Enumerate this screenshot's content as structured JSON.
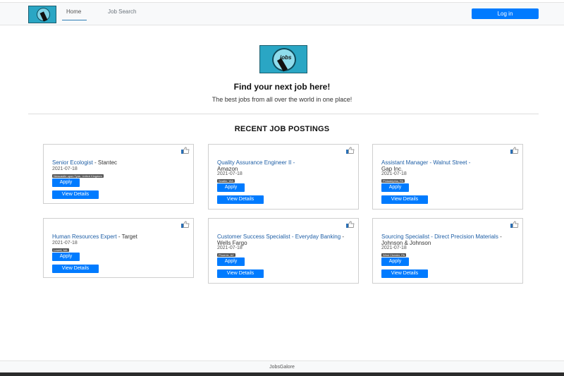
{
  "nav": {
    "logo_icon": "jobs-logo-icon",
    "home_label": "Home",
    "search_label": "Job Search",
    "login_label": "Log in",
    "accent_color": "#007bff"
  },
  "hero": {
    "logo_text": "jobs",
    "title": "Find your next job here!",
    "subtitle": "The best jobs from all over the world in one place!"
  },
  "section": {
    "title": "RECENT JOB POSTINGS"
  },
  "jobs": [
    {
      "title": "Senior Ecologist",
      "company": "Stantec",
      "date": "2021-07-18",
      "location": "Newcastle upon Tyne, United Kingdom",
      "apply_label": "Apply",
      "details_label": "View Details",
      "like_icon": "thumbs-up-icon"
    },
    {
      "title": "Quality Assurance Engineer II",
      "company": "Amazon",
      "date": "2021-07-18",
      "location": "Seattle, WA",
      "apply_label": "Apply",
      "details_label": "View Details",
      "like_icon": "thumbs-up-icon"
    },
    {
      "title": "Assistant Manager - Walnut Street",
      "company": "Gap Inc.",
      "date": "2021-07-18",
      "location": "Philadelphia, PA",
      "apply_label": "Apply",
      "details_label": "View Details",
      "like_icon": "thumbs-up-icon"
    },
    {
      "title": "Human Resources Expert",
      "company": "Target",
      "date": "2021-07-18",
      "location": "Lowell, MA",
      "apply_label": "Apply",
      "details_label": "View Details",
      "like_icon": "thumbs-up-icon"
    },
    {
      "title": "Customer Success Specialist - Everyday Banking",
      "company": "Wells Fargo",
      "date": "2021-07-18",
      "location": "Phoenix, AZ",
      "apply_label": "Apply",
      "details_label": "View Details",
      "like_icon": "thumbs-up-icon"
    },
    {
      "title": "Sourcing Specialist - Direct Precision Materials",
      "company": "Johnson & Johnson",
      "date": "2021-07-18",
      "location": "West Chester, PA",
      "apply_label": "Apply",
      "details_label": "View Details",
      "like_icon": "thumbs-up-icon"
    }
  ],
  "footer": {
    "text": "JobsGalore"
  }
}
